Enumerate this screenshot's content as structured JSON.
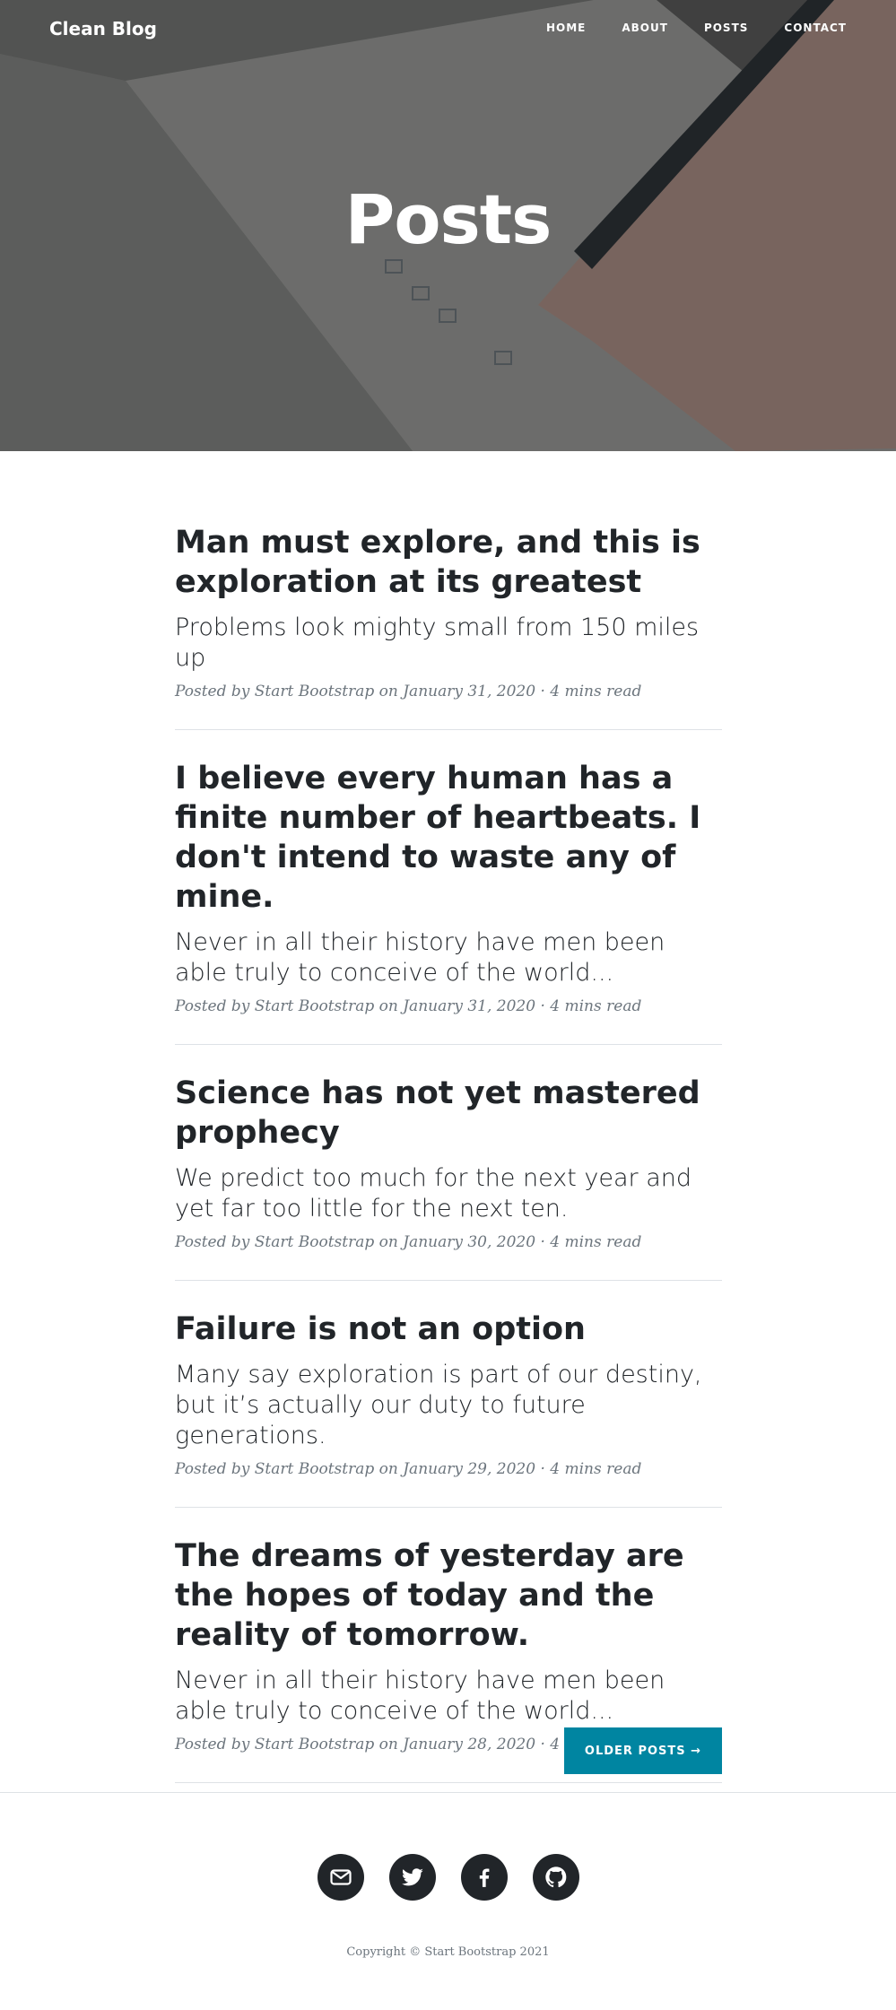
{
  "navbar": {
    "brand": "Clean Blog",
    "links": [
      "HOME",
      "ABOUT",
      "POSTS",
      "CONTACT"
    ]
  },
  "hero": {
    "heading": "Posts"
  },
  "posts": [
    {
      "title": "Man must explore, and this is exploration at its greatest",
      "subtitle": "Problems look mighty small from 150 miles up",
      "meta_prefix": "Posted by ",
      "author": "Start Bootstrap",
      "meta_suffix": " on January 31, 2020 · 4 mins read"
    },
    {
      "title": "I believe every human has a finite number of heartbeats. I don't intend to waste any of mine.",
      "subtitle": "Never in all their history have men been able truly to conceive of the world...",
      "meta_prefix": "Posted by ",
      "author": "Start Bootstrap",
      "meta_suffix": " on January 31, 2020 · 4 mins read"
    },
    {
      "title": "Science has not yet mastered prophecy",
      "subtitle": "We predict too much for the next year and yet far too little for the next ten.",
      "meta_prefix": "Posted by ",
      "author": "Start Bootstrap",
      "meta_suffix": " on January 30, 2020 · 4 mins read"
    },
    {
      "title": "Failure is not an option",
      "subtitle": "Many say exploration is part of our destiny, but it’s actually our duty to future generations.",
      "meta_prefix": "Posted by ",
      "author": "Start Bootstrap",
      "meta_suffix": " on January 29, 2020 · 4 mins read"
    },
    {
      "title": "The dreams of yesterday are the hopes of today and the reality of tomorrow.",
      "subtitle": "Never in all their history have men been able truly to conceive of the world...",
      "meta_prefix": "Posted by ",
      "author": "Start Bootstrap",
      "meta_suffix": " on January 28, 2020 · 4 mins read"
    }
  ],
  "pagination": {
    "older_label": "OLDER POSTS →"
  },
  "footer": {
    "social_icons": [
      "mail-icon",
      "twitter-icon",
      "facebook-icon",
      "github-icon"
    ],
    "copyright": "Copyright © Start Bootstrap 2021"
  },
  "colors": {
    "accent": "#0085a1",
    "text": "#212529",
    "muted": "#6c757d"
  }
}
